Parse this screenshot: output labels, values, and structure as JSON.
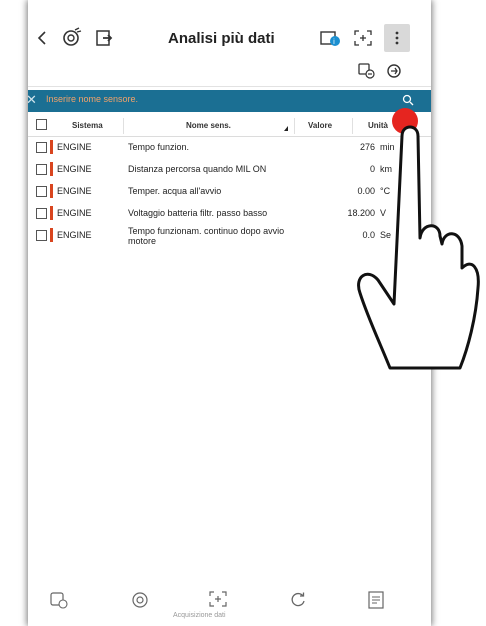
{
  "header": {
    "title": "Analisi più dati"
  },
  "search": {
    "placeholder": "Inserire nome sensore."
  },
  "table": {
    "columns": [
      "Sistema",
      "Nome sens.",
      "Valore",
      "Unità"
    ],
    "rows": [
      {
        "system": "ENGINE",
        "name": "Tempo funzion.",
        "value": "276",
        "unit": "min"
      },
      {
        "system": "ENGINE",
        "name": "Distanza percorsa quando MIL ON",
        "value": "0",
        "unit": "km"
      },
      {
        "system": "ENGINE",
        "name": "Temper. acqua all'avvio",
        "value": "0.00",
        "unit": "°C"
      },
      {
        "system": "ENGINE",
        "name": "Voltaggio batteria filtr. passo basso",
        "value": "18.200",
        "unit": "V"
      },
      {
        "system": "ENGINE",
        "name": "Tempo funzionam. continuo dopo avvio motore",
        "value": "0.0",
        "unit": "Se"
      }
    ]
  },
  "bottombar": {
    "record_label": "Acquisizione dati"
  },
  "colors": {
    "searchbar": "#1b6f93",
    "system_tag": "#d9451f",
    "touch": "#e52520"
  }
}
